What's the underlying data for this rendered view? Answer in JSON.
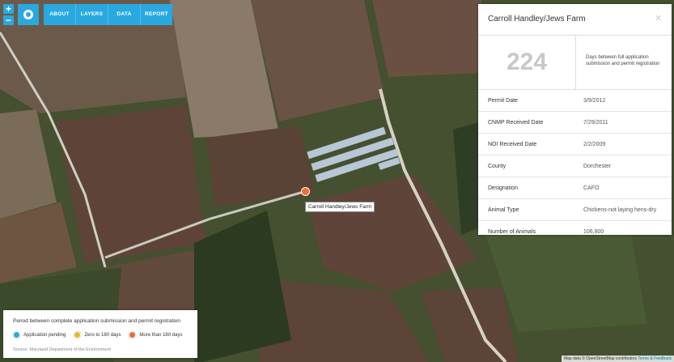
{
  "nav": {
    "zoom_in": "+",
    "zoom_out": "−",
    "items": [
      "ABOUT",
      "LAYERS",
      "DATA",
      "REPORT"
    ]
  },
  "marker": {
    "label": "Carroll Handley/Jews Farm",
    "color": "#ef6a35"
  },
  "panel": {
    "title": "Carroll Handley/Jews Farm",
    "close": "×",
    "stat_value": "224",
    "stat_desc": "Days between full application submission and permit registration",
    "rows": [
      {
        "label": "Permit Date",
        "value": "3/9/2012"
      },
      {
        "label": "CNMP Received Date",
        "value": "7/29/2011"
      },
      {
        "label": "NOI Received Date",
        "value": "2/2/2009"
      },
      {
        "label": "County",
        "value": "Dorchester"
      },
      {
        "label": "Designation",
        "value": "CAFO"
      },
      {
        "label": "Animal Type",
        "value": "Chickens-not laying hens-dry"
      },
      {
        "label": "Number of Animals",
        "value": "106,800"
      }
    ]
  },
  "legend": {
    "title": "Period between complete application submission and permit registration",
    "items": [
      {
        "label": "Application pending",
        "color": "#29a9e0"
      },
      {
        "label": "Zero to 180 days",
        "color": "#e6b527"
      },
      {
        "label": "More than 180 days",
        "color": "#ef6a35"
      }
    ],
    "source": "Source: Maryland Department of the Environment"
  },
  "attribution": {
    "text": "Map data © OpenStreetMap contributors",
    "link": "Terms & Feedback"
  }
}
